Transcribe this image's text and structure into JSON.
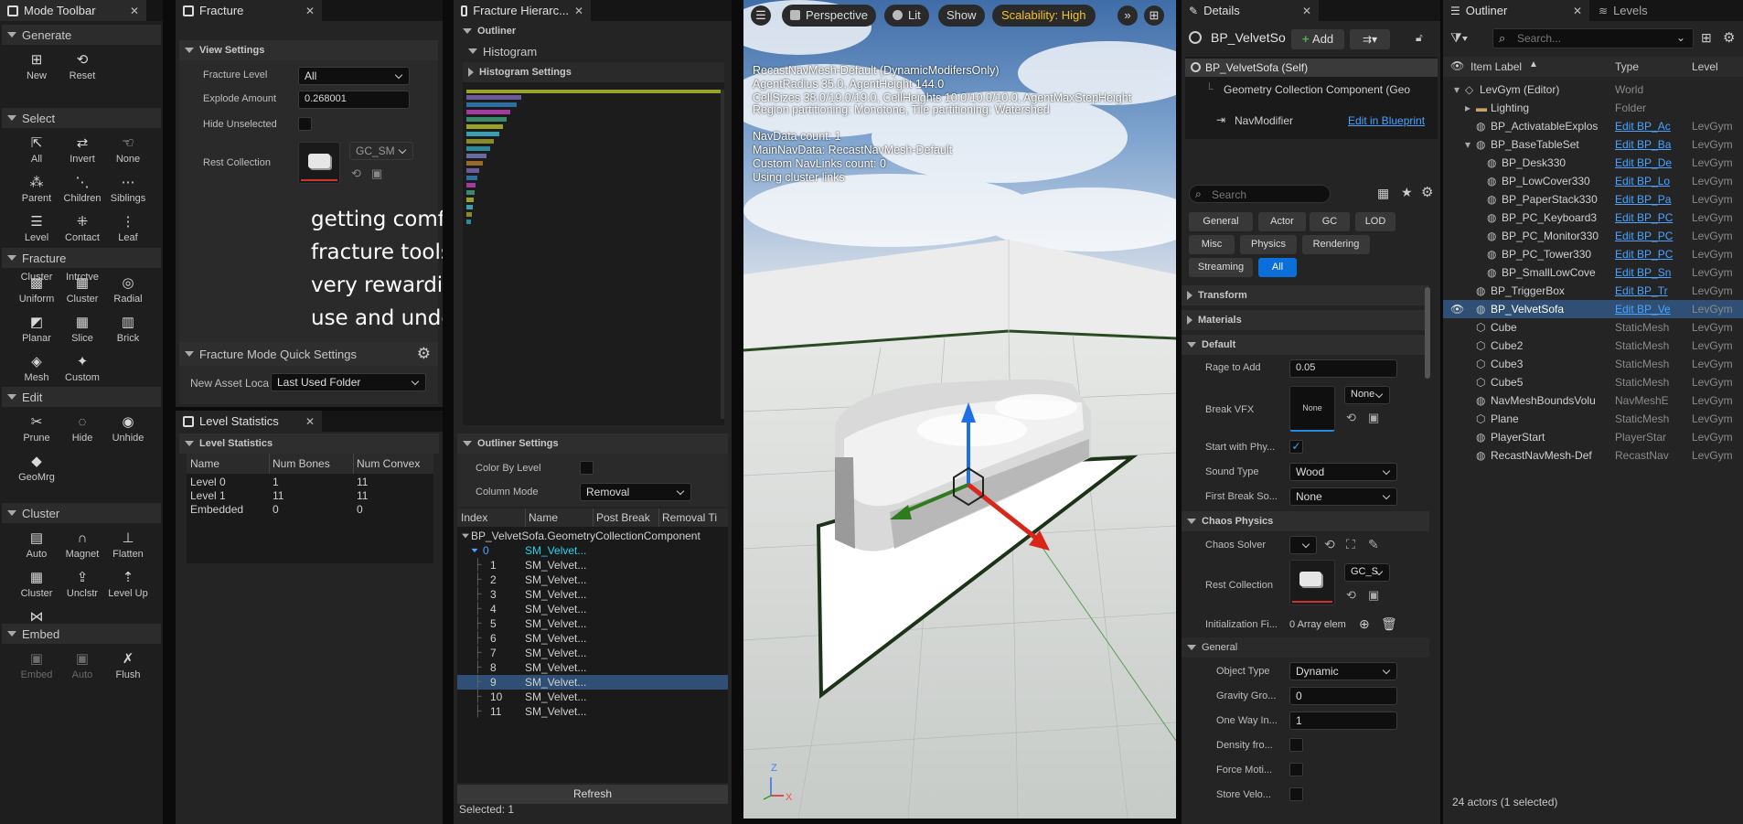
{
  "mode_toolbar": {
    "tab": "Mode Toolbar",
    "sections": [
      {
        "title": "Generate",
        "tools": [
          {
            "label": "New",
            "icon": "new-icon"
          },
          {
            "label": "Reset",
            "icon": "reset-icon"
          }
        ]
      },
      {
        "title": "Select",
        "tools": [
          {
            "label": "All",
            "icon": "select-all-icon"
          },
          {
            "label": "Invert",
            "icon": "invert-icon"
          },
          {
            "label": "None",
            "icon": "select-none-icon"
          },
          {
            "label": "Parent",
            "icon": "parent-icon"
          },
          {
            "label": "Children",
            "icon": "children-icon"
          },
          {
            "label": "Siblings",
            "icon": "siblings-icon"
          },
          {
            "label": "Level",
            "icon": "level-icon"
          },
          {
            "label": "Contact",
            "icon": "contact-icon"
          },
          {
            "label": "Leaf",
            "icon": "leaf-icon"
          },
          {
            "label": "Cluster",
            "icon": "cluster-icon"
          },
          {
            "label": "Intrctve",
            "icon": "interactive-icon"
          }
        ]
      },
      {
        "title": "Fracture",
        "tools": [
          {
            "label": "Uniform",
            "icon": "uniform-icon"
          },
          {
            "label": "Cluster",
            "icon": "cluster-icon"
          },
          {
            "label": "Radial",
            "icon": "radial-icon"
          },
          {
            "label": "Planar",
            "icon": "planar-icon"
          },
          {
            "label": "Slice",
            "icon": "slice-icon"
          },
          {
            "label": "Brick",
            "icon": "brick-icon"
          },
          {
            "label": "Mesh",
            "icon": "mesh-icon"
          },
          {
            "label": "Custom",
            "icon": "custom-icon"
          }
        ]
      },
      {
        "title": "Edit",
        "tools": [
          {
            "label": "Prune",
            "icon": "prune-icon"
          },
          {
            "label": "Hide",
            "icon": "hide-icon"
          },
          {
            "label": "Unhide",
            "icon": "unhide-icon"
          },
          {
            "label": "GeoMrg",
            "icon": "geomerge-icon"
          }
        ]
      },
      {
        "title": "Cluster",
        "tools": [
          {
            "label": "Auto",
            "icon": "auto-cluster-icon"
          },
          {
            "label": "Magnet",
            "icon": "magnet-icon"
          },
          {
            "label": "Flatten",
            "icon": "flatten-icon"
          },
          {
            "label": "Cluster",
            "icon": "cluster-icon"
          },
          {
            "label": "Unclstr",
            "icon": "uncluster-icon"
          },
          {
            "label": "Level Up",
            "icon": "level-up-icon"
          },
          {
            "label": "Merge",
            "icon": "merge-icon"
          }
        ]
      },
      {
        "title": "Embed",
        "tools": [
          {
            "label": "Embed",
            "icon": "embed-icon"
          },
          {
            "label": "Auto",
            "icon": "auto-embed-icon"
          },
          {
            "label": "Flush",
            "icon": "flush-icon"
          }
        ]
      }
    ]
  },
  "fracture": {
    "tab": "Fracture",
    "view_settings": "View Settings",
    "fracture_level_label": "Fracture Level",
    "fracture_level_value": "All",
    "explode_label": "Explode Amount",
    "explode_value": "0.268001",
    "hide_unselected_label": "Hide Unselected",
    "rest_collection_label": "Rest Collection",
    "rest_collection_asset": "GC_SM",
    "overlay_text": "getting comfortable with the fracture tools took a while, but was very rewarding to be able to fluidly use and understand",
    "quick_settings": "Fracture Mode Quick Settings",
    "new_asset_label": "New Asset Loca",
    "new_asset_value": "Last Used Folder"
  },
  "level_stats": {
    "tab": "Level Statistics",
    "section": "Level Statistics",
    "headers": [
      "Name",
      "Num Bones",
      "Num Convex"
    ],
    "rows": [
      [
        "Level 0",
        "1",
        "11"
      ],
      [
        "Level 1",
        "11",
        "11"
      ],
      [
        "Embedded",
        "0",
        "0"
      ]
    ]
  },
  "fracture_hierarchy": {
    "tab": "Fracture Hierarc...",
    "outliner": "Outliner",
    "histogram": "Histogram",
    "histogram_settings": "Histogram Settings",
    "outliner_settings": "Outliner Settings",
    "color_by_level_label": "Color By Level",
    "column_mode_label": "Column Mode",
    "column_mode_value": "Removal",
    "headers": [
      "Index",
      "Name",
      "Post Break",
      "Removal Ti"
    ],
    "root": "BP_VelvetSofa.GeometryCollectionComponent",
    "items": [
      [
        "0",
        "SM_Velvet..."
      ],
      [
        "1",
        "SM_Velvet..."
      ],
      [
        "2",
        "SM_Velvet..."
      ],
      [
        "3",
        "SM_Velvet..."
      ],
      [
        "4",
        "SM_Velvet..."
      ],
      [
        "5",
        "SM_Velvet..."
      ],
      [
        "6",
        "SM_Velvet..."
      ],
      [
        "7",
        "SM_Velvet..."
      ],
      [
        "8",
        "SM_Velvet..."
      ],
      [
        "9",
        "SM_Velvet..."
      ],
      [
        "10",
        "SM_Velvet..."
      ],
      [
        "11",
        "SM_Velvet..."
      ]
    ],
    "refresh": "Refresh",
    "selected": "Selected: 1"
  },
  "viewport": {
    "perspective": "Perspective",
    "lit": "Lit",
    "show": "Show",
    "scalability": "Scalability: High",
    "navmesh_lines": [
      "RecastNavMesh-Default (DynamicModifersOnly)",
      "AgentRadius 35.0, AgentHeight 144.0",
      "CellSizes 38.0/19.0/19.0, CellHeights 10.0/10.0/10.0, AgentMaxStepHeight",
      "Region partitioning: Monotone, Tile partitioning: Watershed",
      "",
      "NavData count: 1",
      "MainNavData: RecastNavMesh-Default",
      "Custom NavLinks count: 0",
      "Using cluster links"
    ],
    "axis_z": "Z",
    "axis_x": "X"
  },
  "details": {
    "tab": "Details",
    "actor": "BP_VelvetSo",
    "add": "Add",
    "components": [
      "BP_VelvetSofa (Self)",
      "Geometry Collection Component (Geo",
      "NavModifier"
    ],
    "edit_in_blueprint": "Edit in Blueprint",
    "search_placeholder": "Search",
    "filters": [
      "General",
      "Actor",
      "GC",
      "LOD",
      "Misc",
      "Physics",
      "Rendering",
      "Streaming",
      "All"
    ],
    "cat_transform": "Transform",
    "cat_materials": "Materials",
    "cat_default": "Default",
    "rage_label": "Rage to Add",
    "rage_value": "0.05",
    "break_vfx_label": "Break VFX",
    "break_vfx_thumb": "None",
    "break_vfx_dd": "None",
    "start_phys_label": "Start with Phy...",
    "sound_type_label": "Sound Type",
    "sound_type_value": "Wood",
    "first_break_label": "First Break So...",
    "first_break_value": "None",
    "cat_chaos": "Chaos Physics",
    "chaos_solver_label": "Chaos Solver",
    "rest_collection_label": "Rest Collection",
    "rest_collection_dd": "GC_S",
    "init_fields_label": "Initialization Fi...",
    "init_fields_value": "0 Array elem",
    "cat_general": "General",
    "object_type_label": "Object Type",
    "object_type_value": "Dynamic",
    "gravity_label": "Gravity Gro...",
    "gravity_value": "0",
    "one_way_label": "One Way In...",
    "one_way_value": "1",
    "density_label": "Density fro...",
    "force_label": "Force Moti...",
    "store_label": "Store Velo..."
  },
  "outliner": {
    "tab": "Outliner",
    "levels_tab": "Levels",
    "search_placeholder": "Search...",
    "headers": [
      "Item Label",
      "Type",
      "Level"
    ],
    "rows": [
      {
        "label": "LevGym (Editor)",
        "type": "World",
        "level": "",
        "indent": 1,
        "link": false
      },
      {
        "label": "Lighting",
        "type": "Folder",
        "level": "",
        "indent": 2,
        "link": false
      },
      {
        "label": "BP_ActivatableExplos",
        "type": "Edit BP_Ac",
        "level": "LevGym",
        "indent": 2,
        "link": true
      },
      {
        "label": "BP_BaseTableSet",
        "type": "Edit BP_Ba",
        "level": "LevGym",
        "indent": 2,
        "link": true
      },
      {
        "label": "BP_Desk330",
        "type": "Edit BP_De",
        "level": "LevGym",
        "indent": 3,
        "link": true
      },
      {
        "label": "BP_LowCover330",
        "type": "Edit BP_Lo",
        "level": "LevGym",
        "indent": 3,
        "link": true
      },
      {
        "label": "BP_PaperStack330",
        "type": "Edit BP_Pa",
        "level": "LevGym",
        "indent": 3,
        "link": true
      },
      {
        "label": "BP_PC_Keyboard3",
        "type": "Edit BP_PC",
        "level": "LevGym",
        "indent": 3,
        "link": true
      },
      {
        "label": "BP_PC_Monitor330",
        "type": "Edit BP_PC",
        "level": "LevGym",
        "indent": 3,
        "link": true
      },
      {
        "label": "BP_PC_Tower330",
        "type": "Edit BP_PC",
        "level": "LevGym",
        "indent": 3,
        "link": true
      },
      {
        "label": "BP_SmallLowCove",
        "type": "Edit BP_Sn",
        "level": "LevGym",
        "indent": 3,
        "link": true
      },
      {
        "label": "BP_TriggerBox",
        "type": "Edit BP_Tr",
        "level": "LevGym",
        "indent": 2,
        "link": true
      },
      {
        "label": "BP_VelvetSofa",
        "type": "Edit BP_Ve",
        "level": "LevGym",
        "indent": 2,
        "link": true
      },
      {
        "label": "Cube",
        "type": "StaticMesh",
        "level": "LevGym",
        "indent": 2,
        "link": false
      },
      {
        "label": "Cube2",
        "type": "StaticMesh",
        "level": "LevGym",
        "indent": 2,
        "link": false
      },
      {
        "label": "Cube3",
        "type": "StaticMesh",
        "level": "LevGym",
        "indent": 2,
        "link": false
      },
      {
        "label": "Cube5",
        "type": "StaticMesh",
        "level": "LevGym",
        "indent": 2,
        "link": false
      },
      {
        "label": "NavMeshBoundsVolu",
        "type": "NavMeshE",
        "level": "LevGym",
        "indent": 2,
        "link": false
      },
      {
        "label": "Plane",
        "type": "StaticMesh",
        "level": "LevGym",
        "indent": 2,
        "link": false
      },
      {
        "label": "PlayerStart",
        "type": "PlayerStar",
        "level": "LevGym",
        "indent": 2,
        "link": false
      },
      {
        "label": "RecastNavMesh-Def",
        "type": "RecastNav",
        "level": "LevGym",
        "indent": 2,
        "link": false
      }
    ],
    "status": "24 actors (1 selected)"
  }
}
